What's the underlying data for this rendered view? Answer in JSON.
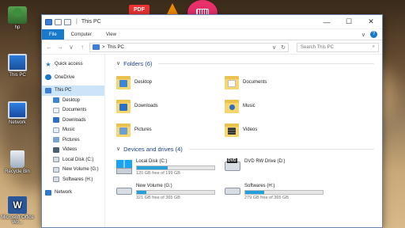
{
  "desktop": {
    "icons": [
      {
        "label": "hp"
      },
      {
        "label": "This PC"
      },
      {
        "label": "Network"
      },
      {
        "label": "Recycle Bin"
      },
      {
        "label": "Microsoft Office Wo..."
      }
    ],
    "top_apps": [
      {
        "label": "PDF"
      }
    ]
  },
  "window": {
    "title": "This PC",
    "quick_access_sep": "|",
    "controls": {
      "minimize": "—",
      "maximize": "☐",
      "close": "✕"
    },
    "ribbon_tabs": [
      "File",
      "Computer",
      "View"
    ],
    "ribbon_right": {
      "expand": "∨",
      "help": "?"
    },
    "address": {
      "back": "←",
      "forward": "→",
      "up": "↑",
      "recent": "∨",
      "crumb_sep": ">",
      "location": "This PC",
      "dropdown": "∨",
      "refresh": "↻",
      "search_placeholder": "Search This PC",
      "search_icon": "⌕"
    }
  },
  "nav_pane": {
    "items": [
      {
        "label": "Quick access",
        "icon": "star-icon",
        "level": 0
      },
      {
        "label": "OneDrive",
        "icon": "cloud-icon",
        "level": 0
      },
      {
        "label": "This PC",
        "icon": "pc-icon",
        "level": 0,
        "selected": true
      },
      {
        "label": "Desktop",
        "icon": "desktop-icon",
        "level": 1
      },
      {
        "label": "Documents",
        "icon": "documents-icon",
        "level": 1
      },
      {
        "label": "Downloads",
        "icon": "downloads-icon",
        "level": 1
      },
      {
        "label": "Music",
        "icon": "music-icon",
        "level": 1
      },
      {
        "label": "Pictures",
        "icon": "pictures-icon",
        "level": 1
      },
      {
        "label": "Videos",
        "icon": "videos-icon",
        "level": 1
      },
      {
        "label": "Local Disk (C:)",
        "icon": "drive-icon",
        "level": 1
      },
      {
        "label": "New Volume (G:)",
        "icon": "drive-icon",
        "level": 1
      },
      {
        "label": "Softwares (H:)",
        "icon": "drive-icon",
        "level": 1
      },
      {
        "label": "Network",
        "icon": "network-icon",
        "level": 0
      }
    ]
  },
  "folders_section": {
    "title": "Folders (6)",
    "chevron": "∨",
    "items": [
      {
        "label": "Desktop",
        "icon": "desktop-folder-icon"
      },
      {
        "label": "Documents",
        "icon": "documents-folder-icon"
      },
      {
        "label": "Downloads",
        "icon": "downloads-folder-icon"
      },
      {
        "label": "Music",
        "icon": "music-folder-icon"
      },
      {
        "label": "Pictures",
        "icon": "pictures-folder-icon"
      },
      {
        "label": "Videos",
        "icon": "videos-folder-icon"
      }
    ]
  },
  "drives_section": {
    "title": "Devices and drives (4)",
    "chevron": "∨",
    "items": [
      {
        "label": "Local Disk (C:)",
        "free_text": "120 GB free of 199 GB",
        "used_fraction": 0.4,
        "icon": "windows-drive-icon"
      },
      {
        "label": "DVD RW Drive (D:)",
        "free_text": "",
        "used_fraction": null,
        "icon": "dvd-drive-icon"
      },
      {
        "label": "New Volume (G:)",
        "free_text": "321 GB free of 365 GB",
        "used_fraction": 0.12,
        "icon": "hdd-icon"
      },
      {
        "label": "Softwares (H:)",
        "free_text": "279 GB free of 365 GB",
        "used_fraction": 0.24,
        "icon": "hdd-icon"
      }
    ]
  },
  "colors": {
    "accent": "#1979ca",
    "selected_bg": "#cce4f7",
    "drive_bar_fill": "#26a0da",
    "keyboard_button": "#e8306b"
  }
}
